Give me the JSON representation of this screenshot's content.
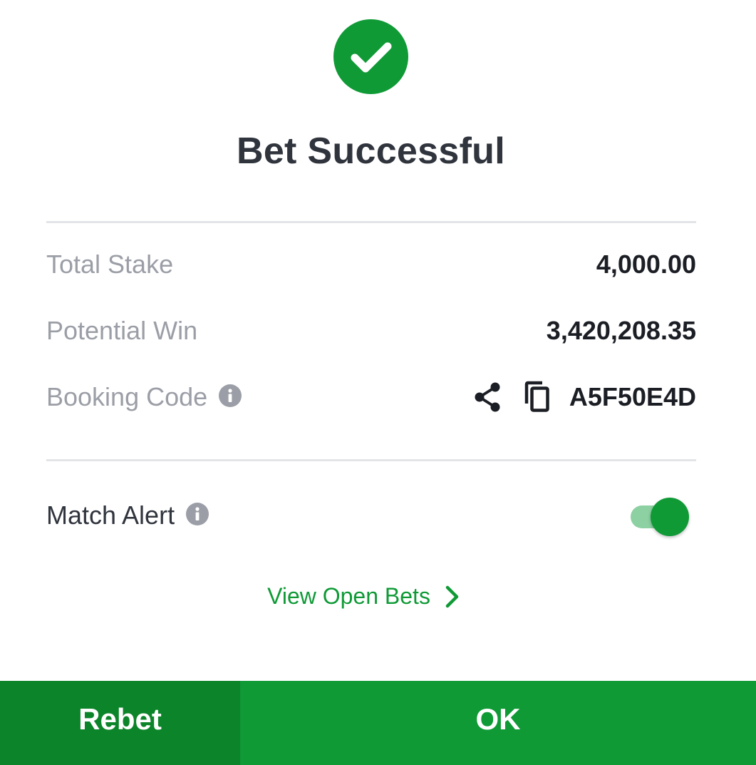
{
  "header": {
    "icon": "check-circle-icon",
    "title": "Bet Successful"
  },
  "summary": {
    "total_stake_label": "Total Stake",
    "total_stake_value": "4,000.00",
    "potential_win_label": "Potential Win",
    "potential_win_value": "3,420,208.35",
    "booking_code_label": "Booking Code",
    "booking_code_value": "A5F50E4D"
  },
  "match_alert": {
    "label": "Match Alert",
    "enabled": true
  },
  "links": {
    "view_open_bets": "View Open Bets"
  },
  "buttons": {
    "rebet": "Rebet",
    "ok": "OK"
  },
  "colors": {
    "accent": "#0f9a36",
    "accent_dark": "#0c8429",
    "toggle_track": "#8dd0a2",
    "label_gray": "#9b9ea6",
    "text_dark": "#30343d"
  }
}
